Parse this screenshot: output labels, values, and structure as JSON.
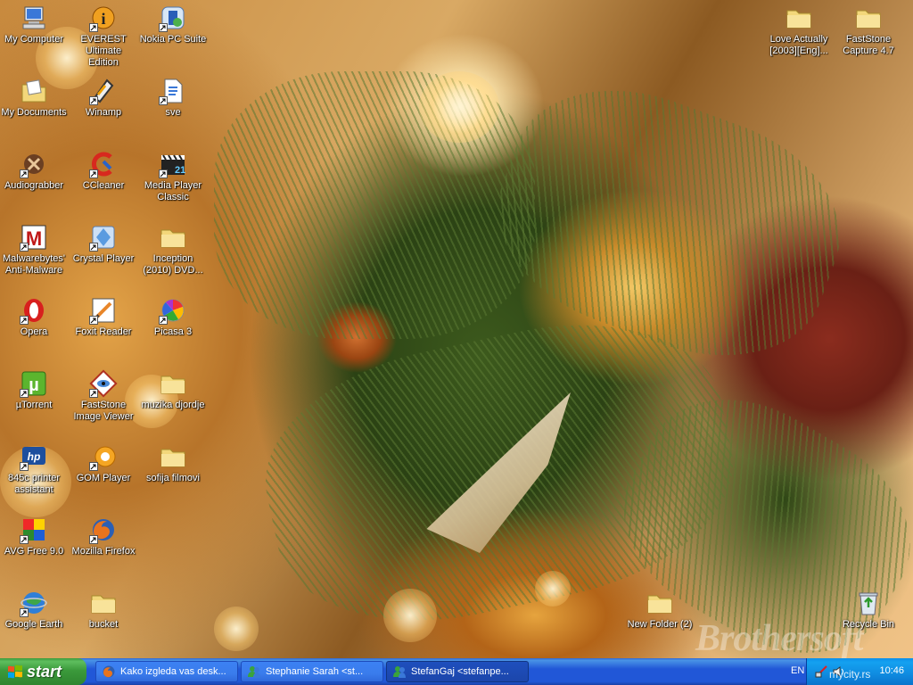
{
  "desktop": {
    "icons": [
      {
        "label": "My Computer",
        "icon": "my-computer-icon",
        "shortcut": false
      },
      {
        "label": "EVEREST Ultimate Edition",
        "icon": "everest-icon",
        "shortcut": true
      },
      {
        "label": "Nokia PC Suite",
        "icon": "nokia-pc-suite-icon",
        "shortcut": true
      },
      {
        "label": "My Documents",
        "icon": "my-documents-icon",
        "shortcut": false
      },
      {
        "label": "Winamp",
        "icon": "winamp-icon",
        "shortcut": true
      },
      {
        "label": "sve",
        "icon": "file-icon",
        "shortcut": true
      },
      {
        "label": "Audiograbber",
        "icon": "audiograbber-icon",
        "shortcut": true
      },
      {
        "label": "CCleaner",
        "icon": "ccleaner-icon",
        "shortcut": true
      },
      {
        "label": "Media Player Classic",
        "icon": "media-player-classic-icon",
        "shortcut": true
      },
      {
        "label": "Malwarebytes' Anti-Malware",
        "icon": "malwarebytes-icon",
        "shortcut": true
      },
      {
        "label": "Crystal Player",
        "icon": "crystal-player-icon",
        "shortcut": true
      },
      {
        "label": "Inception (2010) DVD...",
        "icon": "folder-icon",
        "shortcut": false
      },
      {
        "label": "Opera",
        "icon": "opera-icon",
        "shortcut": true
      },
      {
        "label": "Foxit Reader",
        "icon": "foxit-reader-icon",
        "shortcut": true
      },
      {
        "label": "Picasa 3",
        "icon": "picasa-icon",
        "shortcut": true
      },
      {
        "label": "µTorrent",
        "icon": "utorrent-icon",
        "shortcut": true
      },
      {
        "label": "FastStone Image Viewer",
        "icon": "faststone-viewer-icon",
        "shortcut": true
      },
      {
        "label": "muzika djordje",
        "icon": "folder-icon",
        "shortcut": false
      },
      {
        "label": "845c printer assistant",
        "icon": "hp-printer-icon",
        "shortcut": true
      },
      {
        "label": "GOM Player",
        "icon": "gom-player-icon",
        "shortcut": true
      },
      {
        "label": "sofija filmovi",
        "icon": "folder-icon",
        "shortcut": false
      },
      {
        "label": "AVG Free 9.0",
        "icon": "avg-icon",
        "shortcut": true
      },
      {
        "label": "Mozilla Firefox",
        "icon": "firefox-icon",
        "shortcut": true
      },
      {
        "label": "Google Earth",
        "icon": "google-earth-icon",
        "shortcut": true
      },
      {
        "label": "bucket",
        "icon": "folder-icon",
        "shortcut": false
      },
      {
        "label": "Love Actually [2003][Eng]...",
        "icon": "folder-icon",
        "shortcut": false
      },
      {
        "label": "FastStone Capture 4.7",
        "icon": "folder-icon",
        "shortcut": false
      },
      {
        "label": "New Folder (2)",
        "icon": "folder-icon",
        "shortcut": false
      },
      {
        "label": "Recycle Bin",
        "icon": "recycle-bin-icon",
        "shortcut": false
      }
    ],
    "watermark": "Brothersoft",
    "watermark_url": "mycity.rs"
  },
  "taskbar": {
    "start_label": "start",
    "tasks": [
      {
        "label": "Kako izgleda vas desk...",
        "icon": "firefox-icon",
        "active": false
      },
      {
        "label": "Stephanie Sarah <st...",
        "icon": "messenger-icon",
        "active": false
      },
      {
        "label": "StefanGaj <stefanpe...",
        "icon": "messenger-icon",
        "active": true
      }
    ],
    "language": "EN",
    "clock": "10:46"
  },
  "colors": {
    "taskbar": "#2157d7",
    "start_button": "#3b9a3b",
    "tray": "#0f8be0"
  }
}
